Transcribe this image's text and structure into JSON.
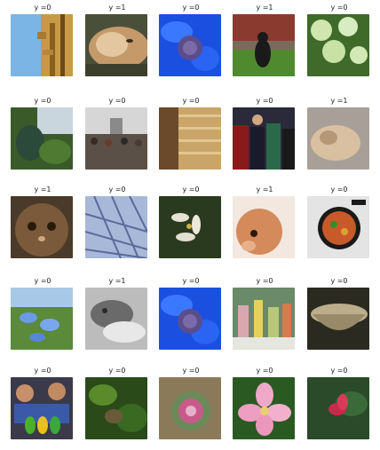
{
  "figure": {
    "panels": [
      {
        "label": "y =0"
      },
      {
        "label": "y =1"
      },
      {
        "label": "y =0"
      },
      {
        "label": "y =1"
      },
      {
        "label": "y =0"
      },
      {
        "label": "y =0"
      },
      {
        "label": "y =0"
      },
      {
        "label": "y =0"
      },
      {
        "label": "y =0"
      },
      {
        "label": "y =1"
      },
      {
        "label": "y =1"
      },
      {
        "label": "y =0"
      },
      {
        "label": "y =0"
      },
      {
        "label": "y =1"
      },
      {
        "label": "y =0"
      },
      {
        "label": "y =0"
      },
      {
        "label": "y =1"
      },
      {
        "label": "y =0"
      },
      {
        "label": "y =0"
      },
      {
        "label": "y =0"
      },
      {
        "label": "y =0"
      },
      {
        "label": "y =0"
      },
      {
        "label": "y =0"
      },
      {
        "label": "y =0"
      },
      {
        "label": "y =0"
      }
    ]
  }
}
